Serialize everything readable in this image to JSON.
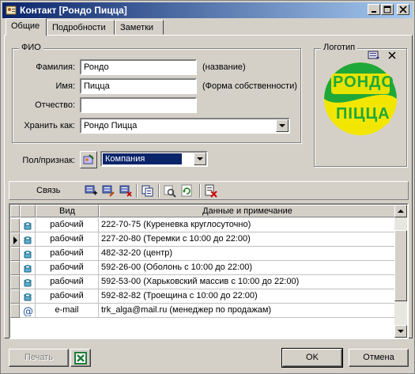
{
  "window": {
    "title": "Контакт [Рондо Пицца]",
    "icon": "contact-card-icon",
    "controls": [
      "minimize-icon",
      "maximize-icon",
      "close-icon"
    ]
  },
  "tabs": [
    {
      "label": "Общие",
      "active": true
    },
    {
      "label": "Подробности",
      "active": false
    },
    {
      "label": "Заметки",
      "active": false
    }
  ],
  "fio": {
    "group_title": "ФИО",
    "last_name_label": "Фамилия:",
    "last_name_value": "Рондо",
    "last_name_hint": "(название)",
    "first_name_label": "Имя:",
    "first_name_value": "Пицца",
    "first_name_hint": "(Форма собственности)",
    "middle_name_label": "Отчество:",
    "middle_name_value": "",
    "save_as_label": "Хранить как:",
    "save_as_value": "Рондо Пицца"
  },
  "logo": {
    "group_title": "Логотип",
    "line1": "РОНДО",
    "line2": "ПIЦЦА",
    "colors": {
      "green": "#1fa83a",
      "yellow": "#f2e600",
      "text": "#1fa83a"
    }
  },
  "gender": {
    "label": "Пол/признак:",
    "value": "Компания",
    "selected_bg": "#0a246a"
  },
  "toolbar": {
    "label": "Связь",
    "icons": [
      "add-phone-icon",
      "edit-phone-icon",
      "delete-phone-icon",
      "copy-icon",
      "search-icon",
      "refresh-icon",
      "export-icon"
    ]
  },
  "grid": {
    "columns": [
      "Вид",
      "Данные и примечание"
    ],
    "rows": [
      {
        "icon": "phone-icon",
        "type": "рабочий",
        "data": "222-70-75 (Куреневка круглосуточно)",
        "current": false
      },
      {
        "icon": "phone-icon",
        "type": "рабочий",
        "data": "227-20-80 (Теремки с 10:00 до 22:00)",
        "current": true
      },
      {
        "icon": "phone-icon",
        "type": "рабочий",
        "data": "482-32-20 (центр)",
        "current": false
      },
      {
        "icon": "phone-icon",
        "type": "рабочий",
        "data": "592-26-00 (Оболонь с 10:00 до 22:00)",
        "current": false
      },
      {
        "icon": "phone-icon",
        "type": "рабочий",
        "data": "592-53-00 (Харьковский массив с 10:00 до 22:00)",
        "current": false
      },
      {
        "icon": "phone-icon",
        "type": "рабочий",
        "data": "592-82-82 (Троещина с 10:00 до 22:00)",
        "current": false
      },
      {
        "icon": "email-icon",
        "type": "e-mail",
        "data": "trk_alga@mail.ru (менеджер по продажам)",
        "current": false
      }
    ]
  },
  "footer": {
    "print_label": "Печать",
    "excel_icon": "excel-icon",
    "ok_label": "OK",
    "cancel_label": "Отмена"
  }
}
